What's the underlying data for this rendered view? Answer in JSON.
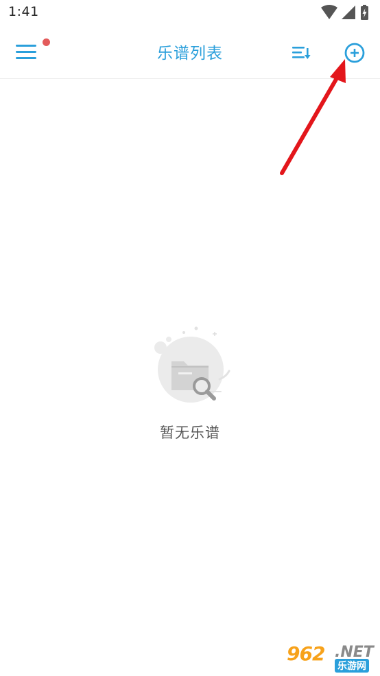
{
  "status_bar": {
    "time": "1:41",
    "icons": [
      "wifi-icon",
      "signal-icon",
      "battery-charging-icon"
    ]
  },
  "toolbar": {
    "title": "乐谱列表",
    "menu_icon": "hamburger-menu-icon",
    "notification_dot_color": "#e35b5b",
    "sort_icon": "sort-list-icon",
    "add_icon": "add-circle-icon",
    "accent_color": "#2a9fdb"
  },
  "empty_state": {
    "icon": "empty-folder-search-icon",
    "message": "暂无乐谱"
  },
  "annotation": {
    "type": "red-arrow",
    "points_to": "add-button",
    "color": "#e3161b"
  },
  "watermark": {
    "number": "962",
    "suffix": ".NET",
    "site": "乐游网"
  }
}
